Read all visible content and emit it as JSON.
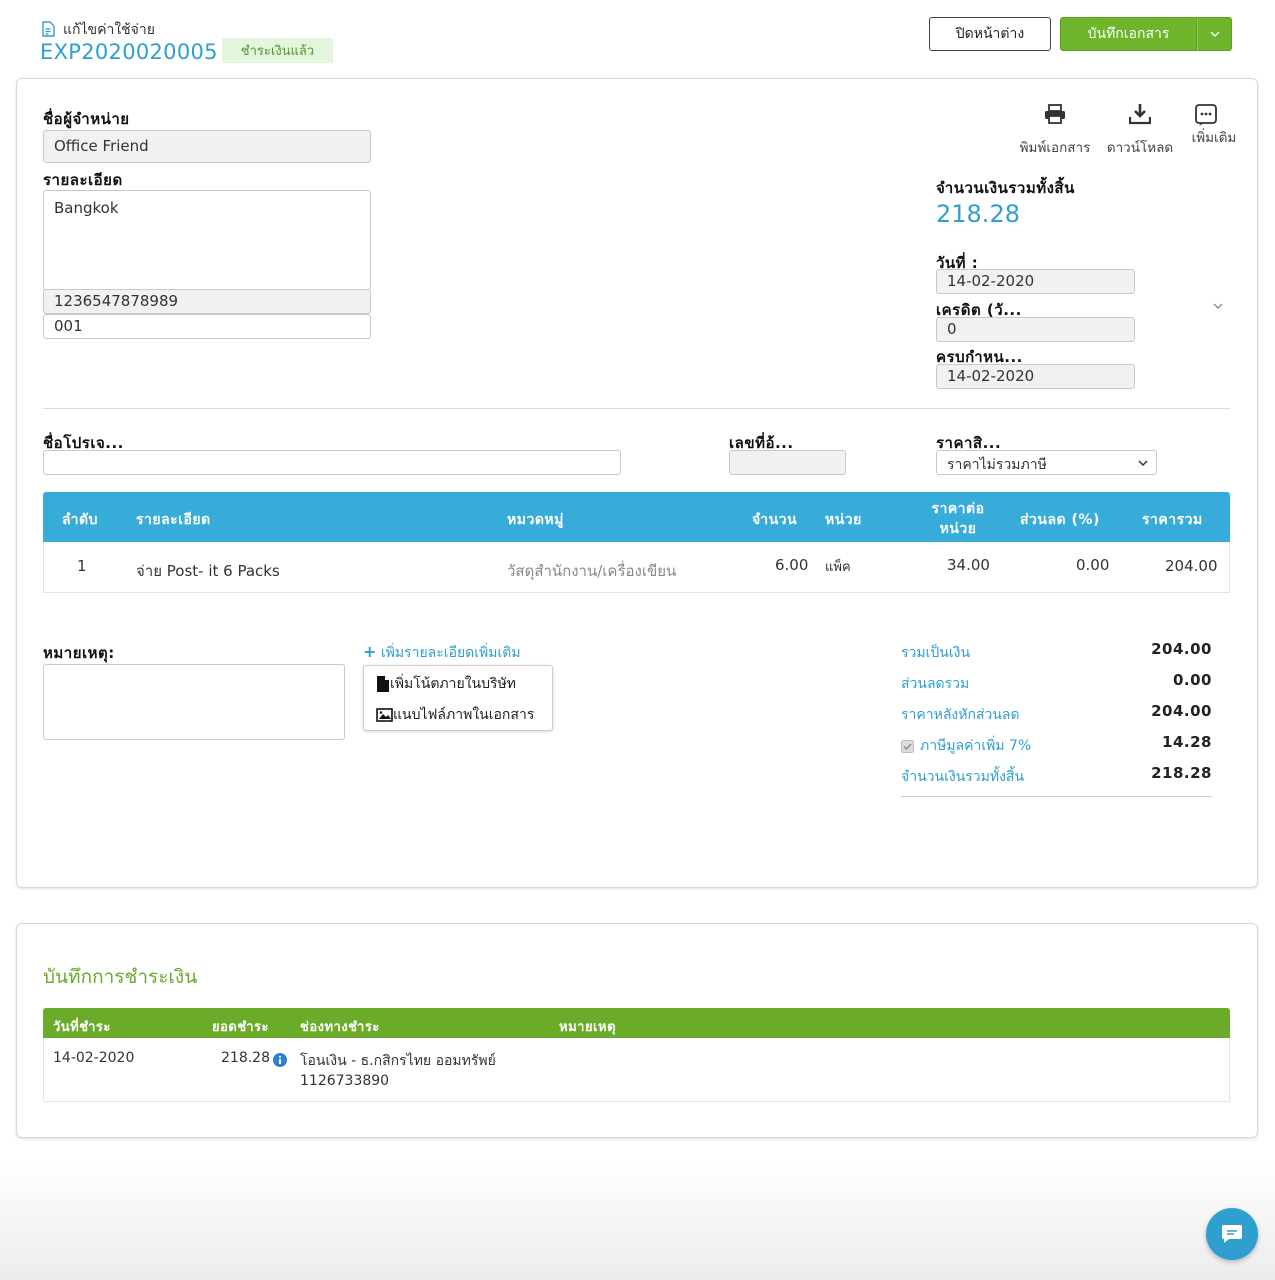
{
  "header": {
    "title": "แก้ไขค่าใช้จ่าย",
    "doc_number": "EXP2020020005",
    "status": "ชำระเงินแล้ว",
    "close_label": "ปิดหน้าต่าง",
    "save_label": "บันทึกเอกสาร"
  },
  "toolbar": {
    "print_label": "พิมพ์เอกสาร",
    "download_label": "ดาวน์โหลด",
    "more_label": "เพิ่มเติม"
  },
  "vendor": {
    "name_label": "ชื่อผู้จำหน่าย",
    "name_value": "Office Friend",
    "details_label": "รายละเอียด",
    "address": "Bangkok",
    "tax_id": "1236547878989",
    "branch": "001"
  },
  "summary_box": {
    "total_label": "จำนวนเงินรวมทั้งสิ้น",
    "total_value": "218.28",
    "date_label": "วันที่ :",
    "date_value": "14-02-2020",
    "credit_label": "เครดิต (วั...",
    "credit_value": "0",
    "due_label": "ครบกำหน...",
    "due_value": "14-02-2020"
  },
  "project": {
    "project_label": "ชื่อโปรเจ...",
    "project_value": "",
    "ref_label": "เลขที่อ้...",
    "ref_value": "",
    "price_label": "ราคาสิ...",
    "price_value": "ราคาไม่รวมภาษี"
  },
  "items_table": {
    "headers": {
      "no": "ลำดับ",
      "desc": "รายละเอียด",
      "category": "หมวดหมู่",
      "qty": "จำนวน",
      "unit": "หน่วย",
      "unit_price_1": "ราคาต่อ",
      "unit_price_2": "หน่วย",
      "discount": "ส่วนลด (%)",
      "total": "ราคารวม"
    },
    "rows": [
      {
        "no": "1",
        "desc": "จ่าย Post- it  6 Packs",
        "category": "วัสดุสำนักงาน/เครื่องเขียน",
        "qty": "6.00",
        "unit": "แพ็ค",
        "unit_price": "34.00",
        "discount": "0.00",
        "total": "204.00"
      }
    ]
  },
  "notes": {
    "label": "หมายเหตุ:",
    "value": "",
    "add_more": "เพิ่มรายละเอียดเพิ่มเติม",
    "menu_internal_note": "เพิ่มโน้ตภายในบริษัท",
    "menu_attach_image": "แนบไฟล์ภาพในเอกสาร"
  },
  "totals": {
    "subtotal_label": "รวมเป็นเงิน",
    "subtotal_value": "204.00",
    "discount_label": "ส่วนลดรวม",
    "discount_value": "0.00",
    "after_discount_label": "ราคาหลังหักส่วนลด",
    "after_discount_value": "204.00",
    "vat_label": "ภาษีมูลค่าเพิ่ม 7%",
    "vat_value": "14.28",
    "grand_label": "จำนวนเงินรวมทั้งสิ้น",
    "grand_value": "218.28"
  },
  "payment": {
    "title": "บันทึกการชำระเงิน",
    "headers": {
      "date": "วันที่ชำระ",
      "amount": "ยอดชำระ",
      "channel": "ช่องทางชำระ",
      "note": "หมายเหตุ"
    },
    "rows": [
      {
        "date": "14-02-2020",
        "amount": "218.28",
        "channel_line1": "โอนเงิน - ธ.กสิกรไทย ออมทรัพย์",
        "channel_line2": "1126733890",
        "note": ""
      }
    ]
  },
  "colors": {
    "accent_blue": "#2f9fd0",
    "table_header_blue": "#38acd9",
    "accent_green": "#6aab2a",
    "status_bg": "#e3f5dc"
  }
}
